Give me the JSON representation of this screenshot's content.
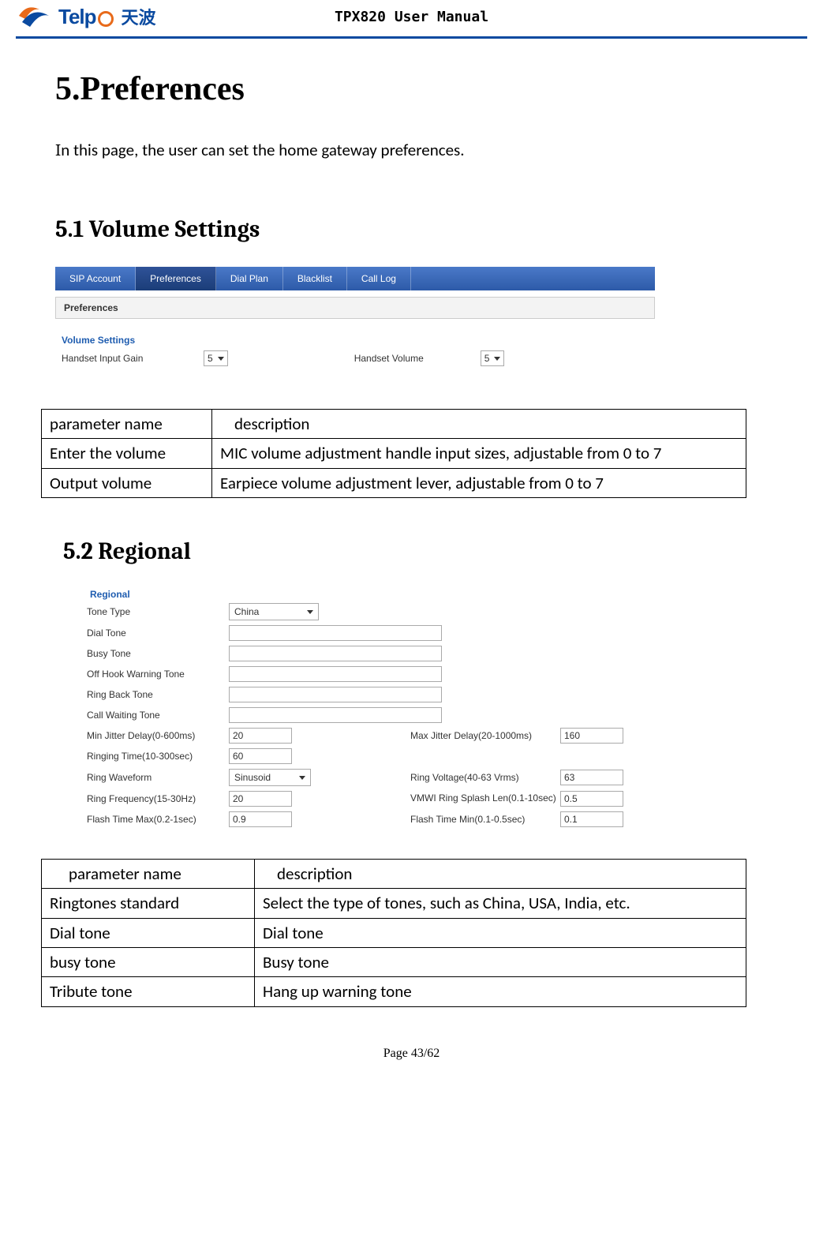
{
  "header": {
    "logo_text": "Telp",
    "logo_cn": "天波",
    "doc_title": "TPX820 User Manual"
  },
  "h1": "5.Preferences",
  "intro": "In this page, the user can set the home gateway preferences.",
  "s51": {
    "title": "5.1 Volume Settings",
    "tabs": [
      "SIP Account",
      "Preferences",
      "Dial Plan",
      "Blacklist",
      "Call Log"
    ],
    "group": "Preferences",
    "legend": "Volume Settings",
    "left_label": "Handset Input Gain",
    "left_value": "5",
    "right_label": "Handset Volume",
    "right_value": "5"
  },
  "table1": {
    "h_name": "parameter name",
    "h_desc": "description",
    "rows": [
      {
        "name": "Enter the volume",
        "desc": "MIC volume adjustment handle input sizes, adjustable from 0 to 7"
      },
      {
        "name": "Output volume",
        "desc": "Earpiece volume adjustment lever, adjustable from 0 to 7"
      }
    ]
  },
  "s52": {
    "title": "5.2 Regional",
    "legend": "Regional",
    "fields": {
      "tone_type_l": "Tone Type",
      "tone_type_v": "China",
      "dial_tone_l": "Dial Tone",
      "busy_tone_l": "Busy Tone",
      "off_hook_l": "Off Hook Warning Tone",
      "ring_back_l": "Ring Back Tone",
      "call_wait_l": "Call Waiting Tone",
      "min_jitter_l": "Min Jitter Delay(0-600ms)",
      "min_jitter_v": "20",
      "max_jitter_l": "Max Jitter Delay(20-1000ms)",
      "max_jitter_v": "160",
      "ringing_time_l": "Ringing Time(10-300sec)",
      "ringing_time_v": "60",
      "ring_wave_l": "Ring Waveform",
      "ring_wave_v": "Sinusoid",
      "ring_volt_l": "Ring Voltage(40-63 Vrms)",
      "ring_volt_v": "63",
      "ring_freq_l": "Ring Frequency(15-30Hz)",
      "ring_freq_v": "20",
      "vmwi_l": "VMWI Ring Splash Len(0.1-10sec)",
      "vmwi_v": "0.5",
      "flash_max_l": "Flash Time Max(0.2-1sec)",
      "flash_max_v": "0.9",
      "flash_min_l": "Flash Time Min(0.1-0.5sec)",
      "flash_min_v": "0.1"
    }
  },
  "table2": {
    "h_name": "parameter name",
    "h_desc": "description",
    "rows": [
      {
        "name": "Ringtones standard",
        "desc": "Select the type of tones, such as China, USA, India, etc."
      },
      {
        "name": "Dial tone",
        "desc": "Dial tone"
      },
      {
        "name": "busy tone",
        "desc": "Busy tone"
      },
      {
        "name": "Tribute tone",
        "desc": "Hang up warning tone"
      }
    ]
  },
  "footer": "Page 43/62"
}
